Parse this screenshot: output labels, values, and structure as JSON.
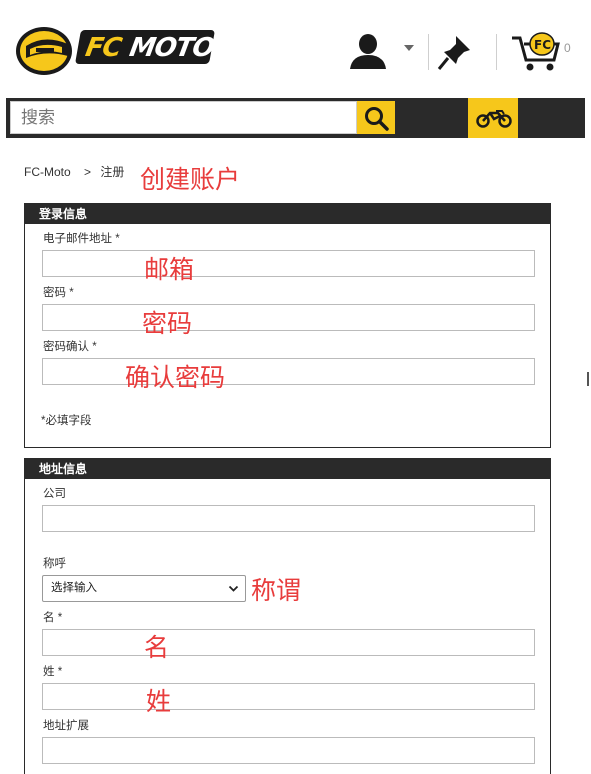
{
  "header": {
    "logo_fc": "FC",
    "logo_moto": "MOTO",
    "cart_count": "0"
  },
  "search": {
    "placeholder": "搜索"
  },
  "breadcrumb": {
    "home": "FC-Moto",
    "separator": ">",
    "current": "注册"
  },
  "annotations": {
    "create_account": "创建账户",
    "email": "邮箱",
    "password": "密码",
    "confirm_password": "确认密码",
    "salutation": "称谓",
    "first_name": "名",
    "last_name": "姓"
  },
  "login_section": {
    "title": "登录信息",
    "email_label": "电子邮件地址 *",
    "password_label": "密码 *",
    "confirm_label": "密码确认 *",
    "required_note": "*必填字段"
  },
  "address_section": {
    "title": "地址信息",
    "company_label": "公司",
    "salutation_label": "称呼",
    "salutation_value": "选择输入",
    "first_name_label": "名 *",
    "last_name_label": "姓 *",
    "address_ext_label": "地址扩展"
  },
  "colors": {
    "brand_yellow": "#f6c71b",
    "dark": "#2a2a2a",
    "annotation_red": "#e83c3c"
  },
  "icons": [
    "helmet-logo-icon",
    "user-icon",
    "chevron-down-icon",
    "pin-icon",
    "cart-icon",
    "search-icon",
    "motorbike-icon"
  ]
}
